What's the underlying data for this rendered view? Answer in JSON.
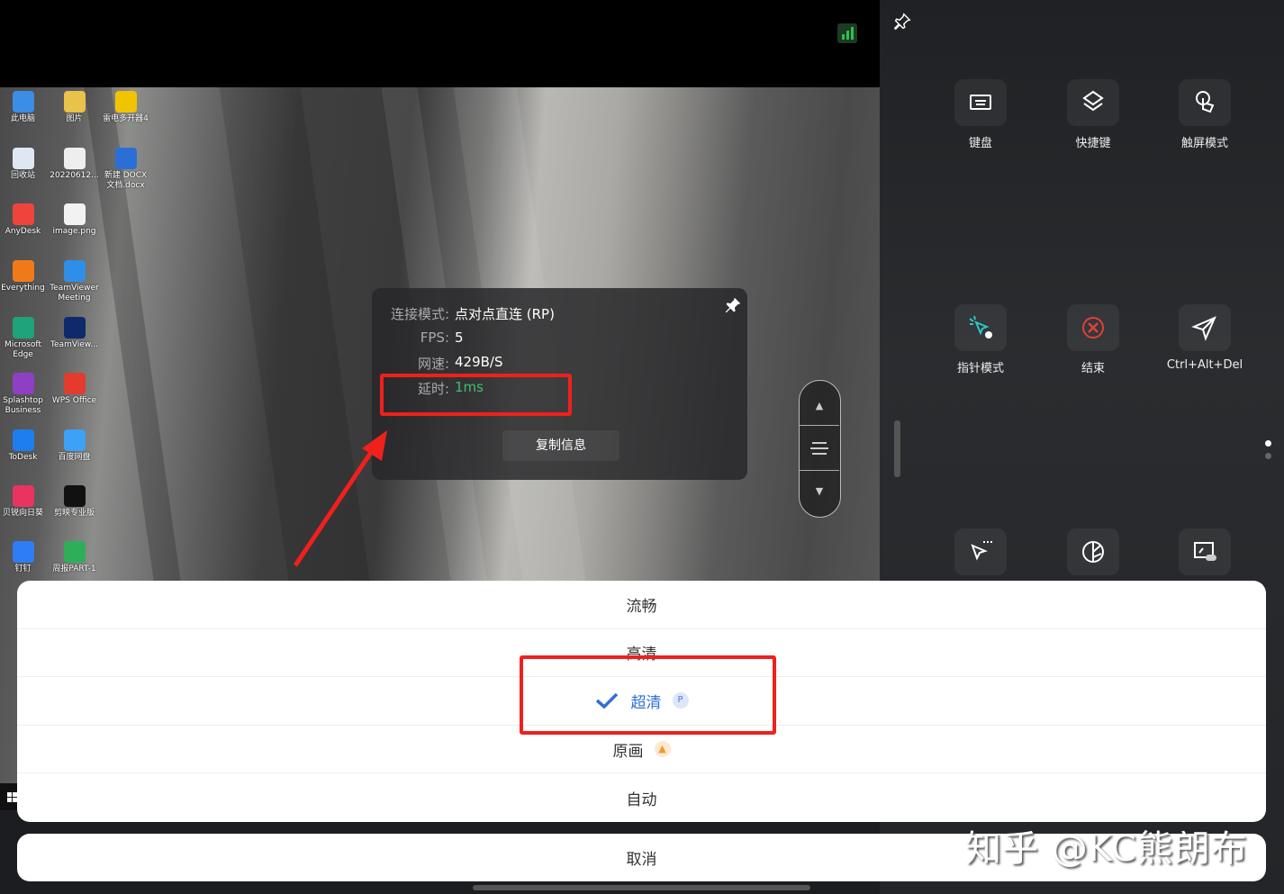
{
  "desktop": {
    "icons": [
      {
        "label": "此电脑",
        "color": "#3a8ee6"
      },
      {
        "label": "图片",
        "color": "#e8c24a"
      },
      {
        "label": "雷电多开器4",
        "color": "#f2c300"
      },
      {
        "label": "回收站",
        "color": "#dfe8f2"
      },
      {
        "label": "20220612...",
        "color": "#eeeeee"
      },
      {
        "label": "新建 DOCX 文档.docx",
        "color": "#2b6fd6"
      },
      {
        "label": "AnyDesk",
        "color": "#ef443b"
      },
      {
        "label": "image.png",
        "color": "#f2f2f2"
      },
      {
        "label": "Everything",
        "color": "#f07a1a"
      },
      {
        "label": "TeamViewer Meeting",
        "color": "#2f8fe6"
      },
      {
        "label": "Microsoft Edge",
        "color": "#1fa37a"
      },
      {
        "label": "TeamView...",
        "color": "#0e2a6b"
      },
      {
        "label": "Splashtop Business",
        "color": "#8e3fc2"
      },
      {
        "label": "WPS Office",
        "color": "#e33b2e"
      },
      {
        "label": "ToDesk",
        "color": "#1e7ef0"
      },
      {
        "label": "百度网盘",
        "color": "#3da1f5"
      },
      {
        "label": "贝锐向日葵",
        "color": "#e8345f"
      },
      {
        "label": "剪映专业版",
        "color": "#111111"
      },
      {
        "label": "钉钉",
        "color": "#2f7df6"
      },
      {
        "label": "周报PART-1",
        "color": "#2fae5a"
      }
    ]
  },
  "signal_icon_color": "#2fbf4f",
  "panel": {
    "tiles": [
      {
        "label": "键盘",
        "icon": "keyboard-icon"
      },
      {
        "label": "快捷键",
        "icon": "shortcut-icon"
      },
      {
        "label": "触屏模式",
        "icon": "touch-icon"
      },
      {
        "label": "指针模式",
        "icon": "pointer-mode-icon"
      },
      {
        "label": "结束",
        "icon": "end-icon"
      },
      {
        "label": "Ctrl+Alt+Del",
        "icon": "send-icon"
      },
      {
        "label": "",
        "icon": "cursor-icon"
      },
      {
        "label": "",
        "icon": "pie-icon"
      },
      {
        "label": "",
        "icon": "screen-toggle-icon"
      }
    ],
    "page_dots": 2,
    "active_page": 1
  },
  "info": {
    "mode_label": "连接模式:",
    "mode_value": "点对点直连 (RP)",
    "fps_label": "FPS:",
    "fps_value": "5",
    "speed_label": "网速:",
    "speed_value": "429B/S",
    "latency_label": "延时:",
    "latency_value": "1ms",
    "copy_label": "复制信息",
    "latency_color": "#3fbf6a"
  },
  "quality_sheet": {
    "options": [
      {
        "label": "流畅",
        "selected": false,
        "badge": ""
      },
      {
        "label": "高清",
        "selected": false,
        "badge": ""
      },
      {
        "label": "超清",
        "selected": true,
        "badge": "P"
      },
      {
        "label": "原画",
        "selected": false,
        "badge": "rocket"
      },
      {
        "label": "自动",
        "selected": false,
        "badge": ""
      }
    ],
    "cancel_label": "取消",
    "accent": "#2f6fd6"
  },
  "watermark": "知乎 @KC熊朗布"
}
